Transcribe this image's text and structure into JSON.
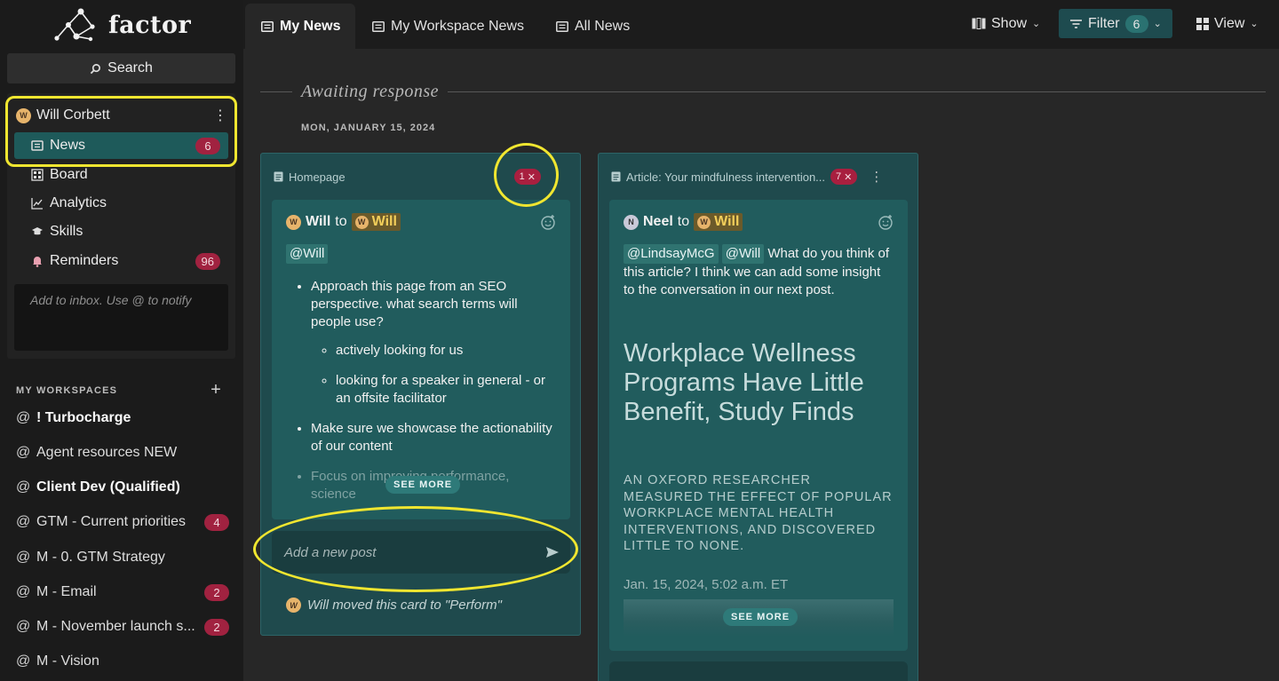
{
  "app": {
    "name": "factor"
  },
  "sidebar": {
    "search_label": "Search",
    "user": {
      "name": "Will Corbett",
      "avatar_initial": "W"
    },
    "nav": [
      {
        "label": "News",
        "badge": "6",
        "icon": "news-icon",
        "active": true
      },
      {
        "label": "Board",
        "badge": "",
        "icon": "board-icon"
      },
      {
        "label": "Analytics",
        "badge": "",
        "icon": "analytics-icon"
      },
      {
        "label": "Skills",
        "badge": "",
        "icon": "skills-icon"
      },
      {
        "label": "Reminders",
        "badge": "96",
        "icon": "bell-icon"
      }
    ],
    "inbox_placeholder": "Add to inbox. Use @ to notify",
    "workspaces_header": "MY WORKSPACES",
    "workspaces": [
      {
        "label": "! Turbocharge",
        "badge": "",
        "bold": true
      },
      {
        "label": "Agent resources NEW",
        "badge": ""
      },
      {
        "label": "Client Dev (Qualified)",
        "badge": "",
        "bold": true
      },
      {
        "label": "GTM - Current priorities",
        "badge": "4"
      },
      {
        "label": "M - 0. GTM Strategy",
        "badge": ""
      },
      {
        "label": "M - Email",
        "badge": "2"
      },
      {
        "label": "M - November launch s...",
        "badge": "2"
      },
      {
        "label": "M - Vision",
        "badge": ""
      }
    ]
  },
  "topbar": {
    "tabs": [
      {
        "label": "My News",
        "active": true
      },
      {
        "label": "My Workspace News"
      },
      {
        "label": "All News"
      }
    ],
    "show_label": "Show",
    "filter_label": "Filter",
    "filter_count": "6",
    "view_label": "View"
  },
  "main": {
    "section_title": "Awaiting response",
    "date_label": "MON, JANUARY 15, 2024",
    "cards": [
      {
        "source": "Homepage",
        "count": "1",
        "post": {
          "from": "Will",
          "to_word": "to",
          "to": "Will",
          "mention": "@Will",
          "bullets": [
            "Approach this page from an SEO perspective. what search terms will people use?",
            "actively looking for us",
            "looking for a speaker in general - or an offsite facilitator",
            "Make sure we showcase the actionability of our content",
            "Focus on improving performance, science"
          ],
          "see_more": "SEE MORE"
        },
        "add_post_placeholder": "Add a new post",
        "activity": "Will moved this card to \"Perform\""
      },
      {
        "source": "Article: Your mindfulness intervention...",
        "count": "7",
        "post": {
          "from": "Neel",
          "to_word": "to",
          "to": "Will",
          "mention1": "@LindsayMcG",
          "mention2": "@Will",
          "text": "What do you think of this article? I think we can add some insight to the conversation in our next post.",
          "article_title": "Workplace Wellness Programs Have Little Benefit, Study Finds",
          "article_sub": "AN OXFORD RESEARCHER MEASURED THE EFFECT OF POPULAR WORKPLACE MENTAL HEALTH INTERVENTIONS, AND DISCOVERED LITTLE TO NONE.",
          "article_date": "Jan. 15, 2024, 5:02 a.m. ET",
          "see_more": "SEE MORE"
        }
      }
    ]
  },
  "colors": {
    "accent_teal": "#1e5a5a",
    "badge_red": "#a12240",
    "highlight_yellow": "#f0e630",
    "mention_gold": "#f3cf5a"
  }
}
